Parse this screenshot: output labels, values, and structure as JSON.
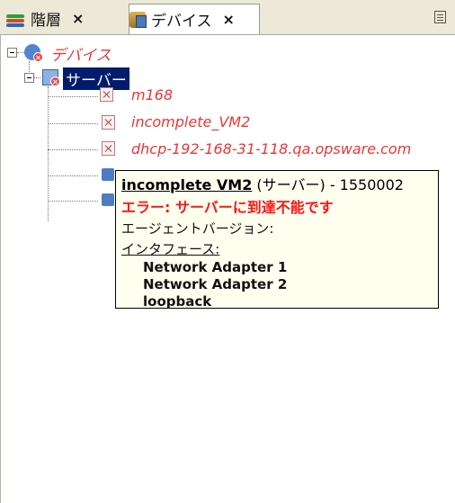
{
  "tabs": [
    {
      "label": "階層",
      "close": "×"
    },
    {
      "label": "デバイス",
      "close": "×"
    }
  ],
  "tree": {
    "root_label": "デバイス",
    "servers_label": "サーバー",
    "items": [
      {
        "label": "m168"
      },
      {
        "label": "incomplete_VM2"
      },
      {
        "label": "dhcp-192-168-31-118.qa.opsware.com"
      }
    ]
  },
  "tooltip": {
    "name": "incomplete VM2",
    "meta": " (サーバー) - 1550002",
    "error": "エラー: サーバーに到達不能です",
    "agent_version_label": "エージェントバージョン:",
    "interfaces_label": "インタフェース:",
    "interfaces": [
      "Network Adapter 1",
      "Network Adapter 2",
      "loopback"
    ]
  },
  "colors": {
    "error_text": "#ef3535",
    "selection": "#001c6b",
    "tooltip_bg": "#fffff0"
  }
}
